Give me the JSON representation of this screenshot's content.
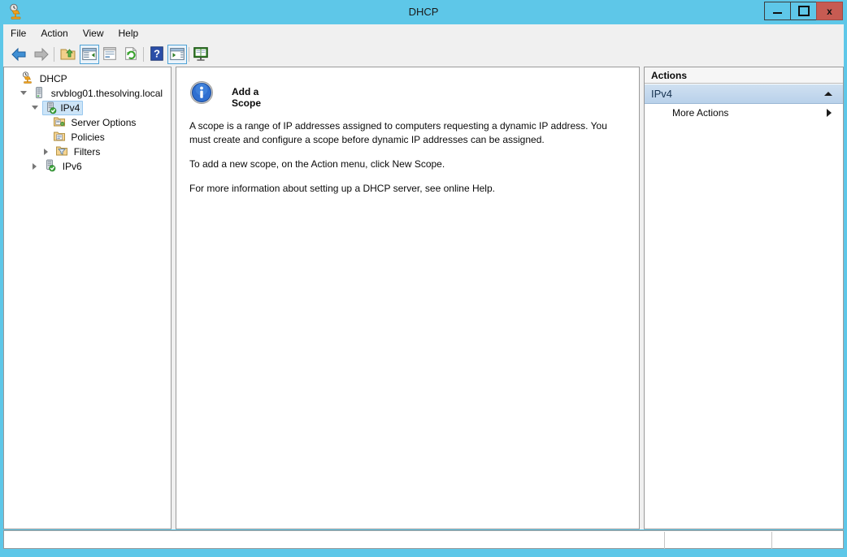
{
  "window": {
    "title": "DHCP",
    "app_icon": "dhcp-server-icon",
    "controls": {
      "minimize": "minimize-button",
      "maximize": "maximize-button",
      "close_label": "x"
    }
  },
  "menubar": {
    "items": [
      {
        "label": "File"
      },
      {
        "label": "Action"
      },
      {
        "label": "View"
      },
      {
        "label": "Help"
      }
    ]
  },
  "toolbar": {
    "buttons": [
      {
        "icon": "back-arrow-icon",
        "name": "back-button",
        "framed": false
      },
      {
        "icon": "forward-arrow-icon",
        "name": "forward-button",
        "framed": false
      },
      {
        "icon": "up-folder-icon",
        "name": "up-one-level-button",
        "framed": false
      },
      {
        "icon": "show-hide-console-tree-icon",
        "name": "show-hide-console-tree-button",
        "framed": true
      },
      {
        "icon": "properties-icon",
        "name": "properties-button",
        "framed": false
      },
      {
        "icon": "refresh-icon",
        "name": "refresh-button",
        "framed": false
      },
      {
        "icon": "help-icon",
        "name": "help-button",
        "framed": false
      },
      {
        "icon": "show-hide-action-pane-icon",
        "name": "show-hide-action-pane-button",
        "framed": true
      },
      {
        "icon": "export-list-icon",
        "name": "export-list-button",
        "framed": false
      }
    ]
  },
  "tree": {
    "nodes": [
      {
        "label": "DHCP",
        "icon": "dhcp-root-icon",
        "indent": 0,
        "expander": "none",
        "selected": false
      },
      {
        "label": "srvblog01.thesolving.local",
        "icon": "server-icon",
        "indent": 1,
        "expander": "open",
        "selected": false
      },
      {
        "label": "IPv4",
        "icon": "ipv4-icon",
        "indent": 2,
        "expander": "open",
        "selected": true
      },
      {
        "label": "Server Options",
        "icon": "server-options-folder-icon",
        "indent": 3,
        "expander": "none",
        "selected": false
      },
      {
        "label": "Policies",
        "icon": "policies-folder-icon",
        "indent": 3,
        "expander": "none",
        "selected": false
      },
      {
        "label": "Filters",
        "icon": "filters-folder-icon",
        "indent": 3,
        "expander": "closed",
        "selected": false
      },
      {
        "label": "IPv6",
        "icon": "ipv6-icon",
        "indent": 2,
        "expander": "closed",
        "selected": false
      }
    ]
  },
  "main": {
    "icon": "information-icon",
    "title": "Add a Scope",
    "paragraphs": [
      "A scope is a range of IP addresses assigned to computers requesting a dynamic IP address. You must create and configure a scope before dynamic IP addresses can be assigned.",
      "To add a new scope, on the Action menu, click New Scope.",
      "For more information about setting up a DHCP server, see online Help."
    ]
  },
  "actions": {
    "header": "Actions",
    "group": {
      "label": "IPv4",
      "collapse_icon": "chevron-up-icon"
    },
    "items": [
      {
        "label": "More Actions",
        "submenu_icon": "chevron-right-icon"
      }
    ]
  },
  "statusbar": {
    "cells": [
      "",
      "",
      ""
    ]
  },
  "colors": {
    "window_frame": "#5ec7e8",
    "close_button": "#c75b52",
    "selection": "#cce4f7",
    "actions_group": "#c3d7ec"
  }
}
